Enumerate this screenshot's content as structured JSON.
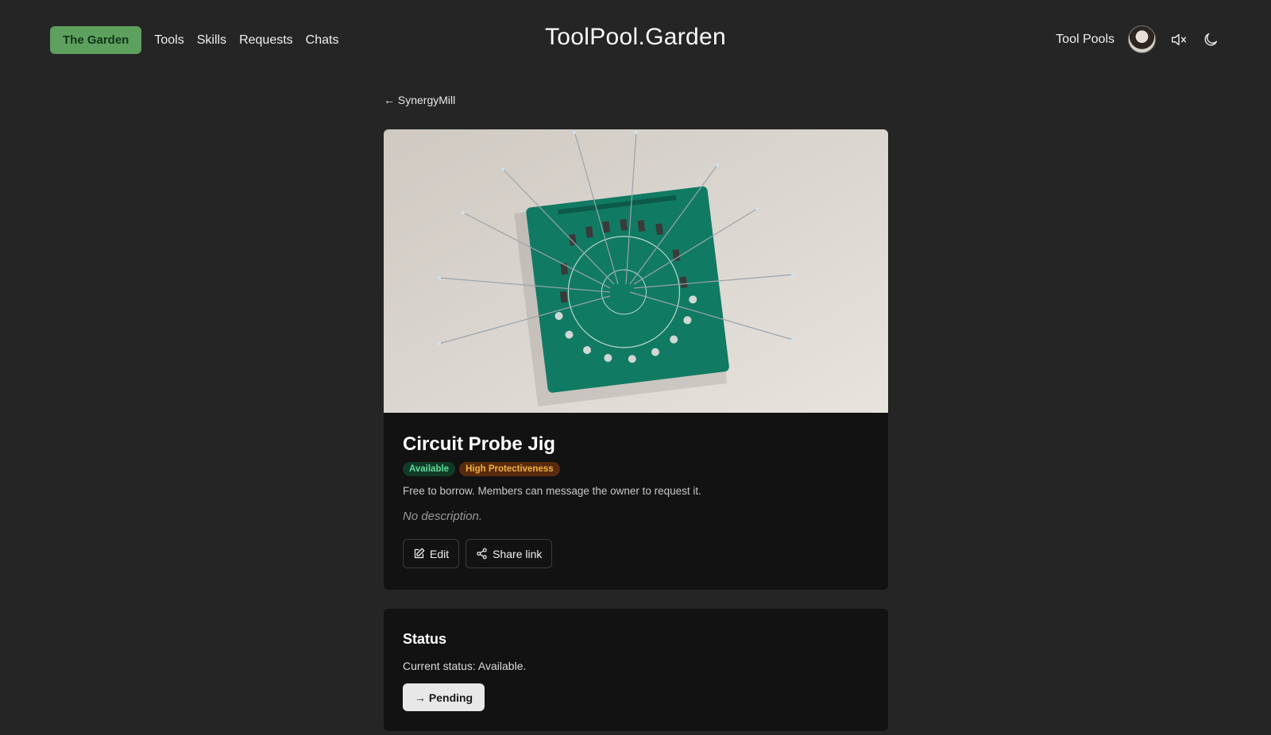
{
  "nav": {
    "garden_label": "The Garden",
    "links": [
      "Tools",
      "Skills",
      "Requests",
      "Chats"
    ],
    "site_title": "ToolPool.Garden",
    "tool_pools_label": "Tool Pools",
    "icons": [
      "avatar",
      "mute-icon",
      "moon-icon"
    ]
  },
  "back": {
    "label": "← SynergyMill"
  },
  "tool": {
    "name": "Circuit Probe Jig",
    "badges": {
      "available": "Available",
      "protectiveness": "High Protectiveness"
    },
    "hint": "Free to borrow. Members can message the owner to request it.",
    "description": "No description.",
    "edit_label": "Edit",
    "share_label": "Share link"
  },
  "status": {
    "title": "Status",
    "text": "Current status: Available.",
    "action_label": "→ Pending"
  },
  "colors": {
    "background": "#252525",
    "card": "#121212",
    "accent": "#5ea05e"
  }
}
